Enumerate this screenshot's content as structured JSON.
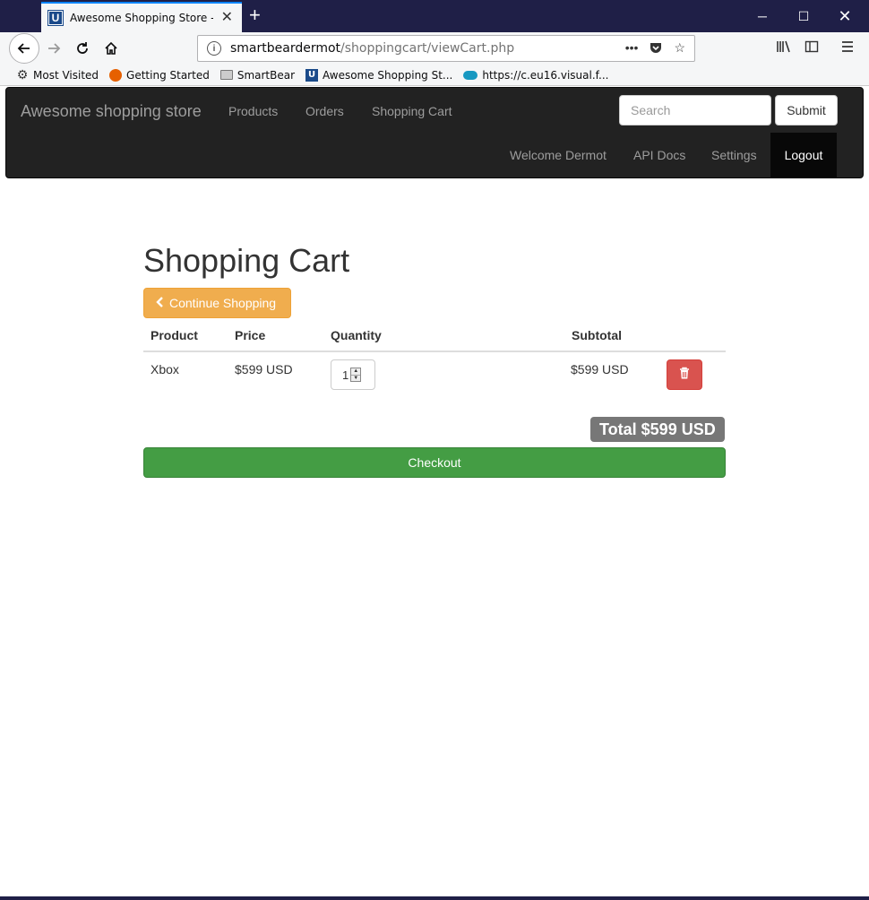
{
  "browser": {
    "tab_title": "Awesome Shopping Store - Vie",
    "tab_favicon_letter": "U",
    "url_host": "smartbeardermot",
    "url_path": "/shoppingcart/viewCart.php",
    "bookmarks": [
      {
        "label": "Most Visited",
        "icon": "gear-icon"
      },
      {
        "label": "Getting Started",
        "icon": "firefox-icon"
      },
      {
        "label": "SmartBear",
        "icon": "folder-icon"
      },
      {
        "label": "Awesome Shopping St...",
        "icon": "u-logo-icon"
      },
      {
        "label": "https://c.eu16.visual.f...",
        "icon": "cloud-icon"
      }
    ]
  },
  "site": {
    "brand": "Awesome shopping store",
    "nav": {
      "products": "Products",
      "orders": "Orders",
      "cart": "Shopping Cart"
    },
    "search_placeholder": "Search",
    "submit_label": "Submit",
    "user_nav": {
      "welcome": "Welcome Dermot",
      "api_docs": "API Docs",
      "settings": "Settings",
      "logout": "Logout"
    }
  },
  "cart": {
    "heading": "Shopping Cart",
    "continue_label": "Continue Shopping",
    "columns": {
      "product": "Product",
      "price": "Price",
      "quantity": "Quantity",
      "subtotal": "Subtotal"
    },
    "items": [
      {
        "product": "Xbox",
        "price": "$599 USD",
        "quantity": "1",
        "subtotal": "$599 USD"
      }
    ],
    "total": "Total $599 USD",
    "checkout_label": "Checkout"
  },
  "colors": {
    "navbar": "#222222",
    "warning": "#f0ad4e",
    "danger": "#d9534f",
    "success": "#449d44",
    "badge": "#777777"
  }
}
